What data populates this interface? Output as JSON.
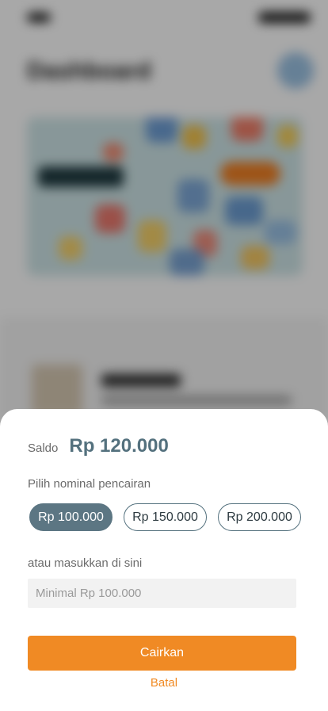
{
  "background": {
    "title": "Dashboard"
  },
  "sheet": {
    "saldo_label": "Saldo",
    "saldo_value": "Rp 120.000",
    "choose_label": "Pilih nominal pencairan",
    "options": [
      {
        "label": "Rp 100.000",
        "selected": true
      },
      {
        "label": "Rp 150.000",
        "selected": false
      },
      {
        "label": "Rp 200.000",
        "selected": false
      }
    ],
    "or_label": "atau masukkan di sini",
    "input_value": "",
    "input_placeholder": "Minimal Rp 100.000",
    "submit_label": "Cairkan",
    "cancel_label": "Batal"
  },
  "colors": {
    "accent": "#f08a24",
    "primary_slate": "#54717e",
    "chip_selected_bg": "#5c7683"
  }
}
